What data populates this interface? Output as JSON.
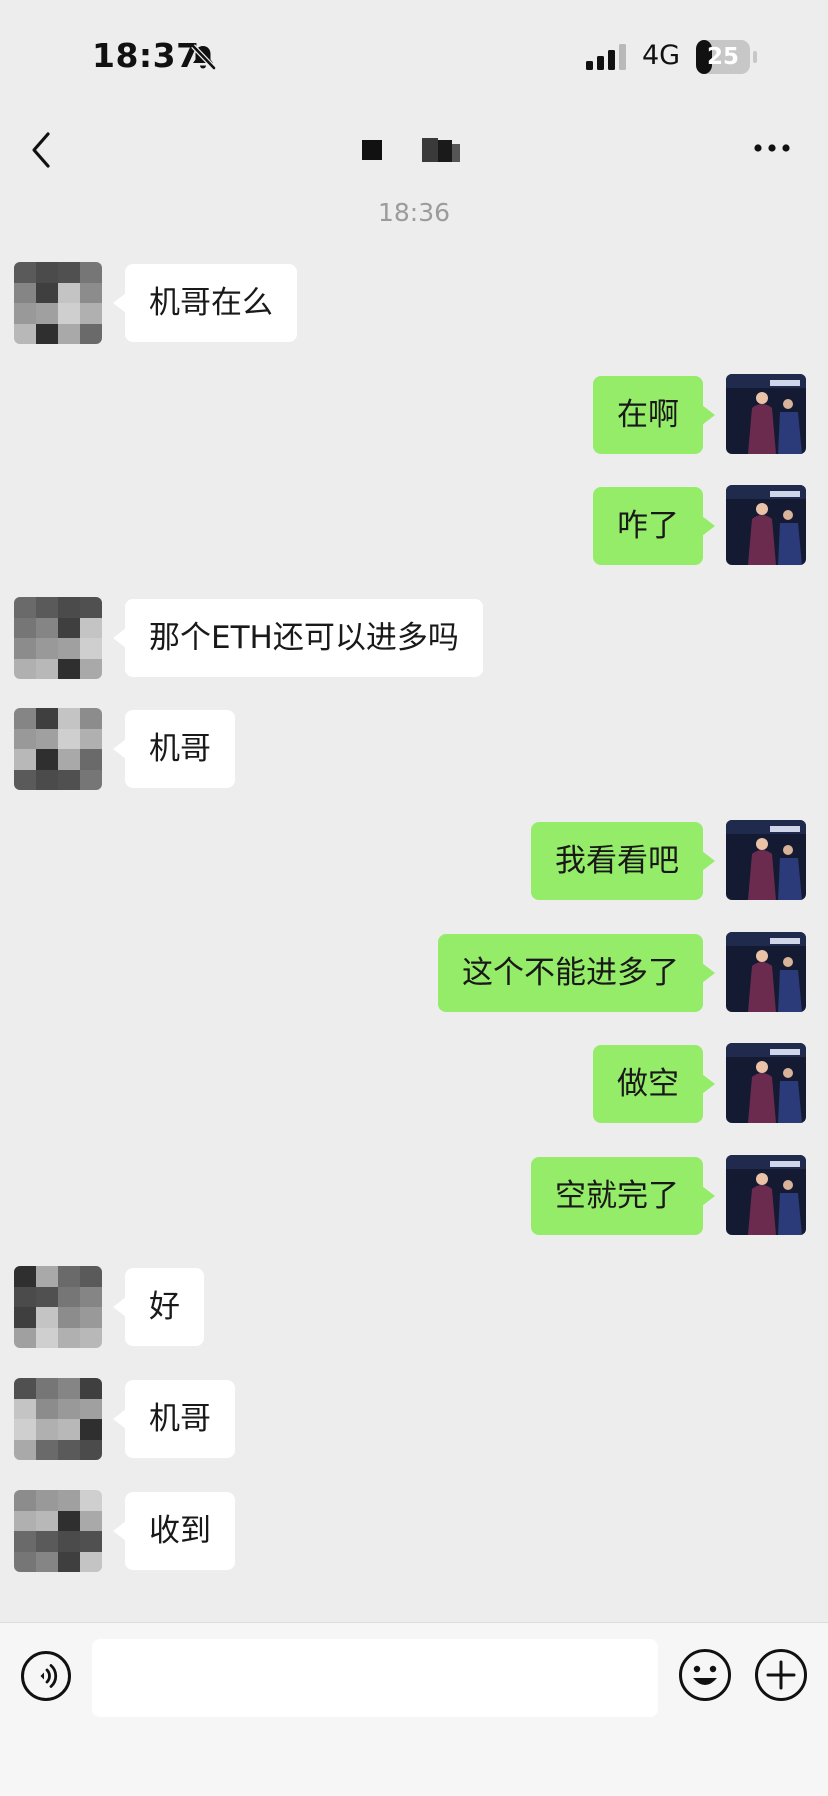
{
  "status_bar": {
    "time": "18:37",
    "network": "4G",
    "battery": "25",
    "mute_icon": "bell-slash-icon",
    "signal_icon": "signal-bars-icon"
  },
  "nav": {
    "back_icon": "chevron-left-icon",
    "more_icon": "ellipsis-icon"
  },
  "chat": {
    "time_separator": "18:36",
    "messages": [
      {
        "side": "left",
        "text": "机哥在么"
      },
      {
        "side": "right",
        "text": "在啊"
      },
      {
        "side": "right",
        "text": "咋了"
      },
      {
        "side": "left",
        "text": "那个ETH还可以进多吗"
      },
      {
        "side": "left",
        "text": "机哥"
      },
      {
        "side": "right",
        "text": "我看看吧"
      },
      {
        "side": "right",
        "text": "这个不能进多了"
      },
      {
        "side": "right",
        "text": "做空"
      },
      {
        "side": "right",
        "text": "空就完了"
      },
      {
        "side": "left",
        "text": "好"
      },
      {
        "side": "left",
        "text": "机哥"
      },
      {
        "side": "left",
        "text": "收到"
      }
    ]
  },
  "input_bar": {
    "voice_icon": "voice-icon",
    "emoji_icon": "emoji-icon",
    "plus_icon": "plus-icon",
    "text_value": ""
  },
  "colors": {
    "background": "#ededed",
    "sent_bubble": "#95ec69",
    "received_bubble": "#ffffff",
    "timestamp": "#9b9b9b"
  }
}
